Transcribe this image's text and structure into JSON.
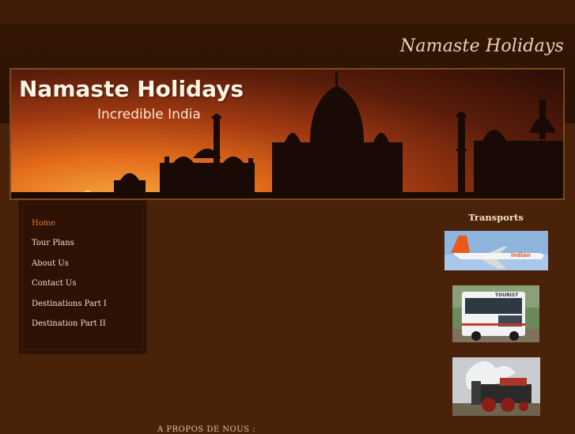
{
  "site": {
    "title": "Namaste Holidays"
  },
  "banner": {
    "title": "Namaste Holidays",
    "subtitle": "Incredible India"
  },
  "nav": {
    "items": [
      {
        "label": "Home",
        "active": true
      },
      {
        "label": "Tour Plans",
        "active": false
      },
      {
        "label": "About Us",
        "active": false
      },
      {
        "label": "Contact Us",
        "active": false
      },
      {
        "label": "Destinations Part I",
        "active": false
      },
      {
        "label": "Destination Part II",
        "active": false
      }
    ]
  },
  "transports": {
    "title": "Transports",
    "images": [
      {
        "icon": "airplane-photo",
        "text": "Indian"
      },
      {
        "icon": "tourist-bus-photo",
        "text": "TOURIST"
      },
      {
        "icon": "steam-train-photo",
        "text": ""
      }
    ]
  },
  "footer": {
    "link": "A PROPOS DE NOUS :"
  },
  "colors": {
    "background": "#4a2109",
    "accent": "#e0783a",
    "text": "#efe2cc"
  }
}
